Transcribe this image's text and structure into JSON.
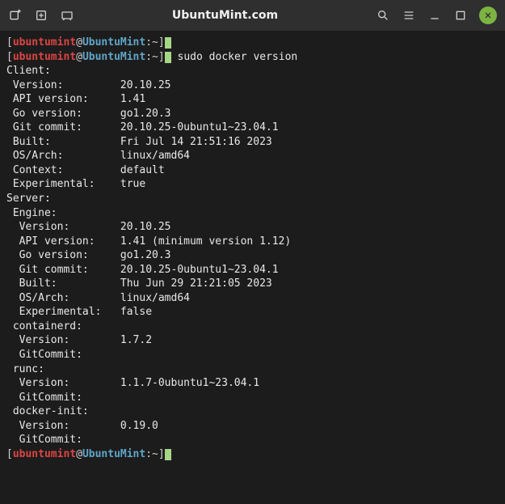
{
  "titlebar": {
    "title": "UbuntuMint.com"
  },
  "prompt": {
    "user": "ubuntumint",
    "host": "UbuntuMint",
    "path": "~"
  },
  "command": "sudo docker version",
  "output": {
    "client_header": "Client:",
    "client_kv": [
      {
        "k": " Version:",
        "v": "20.10.25"
      },
      {
        "k": " API version:",
        "v": "1.41"
      },
      {
        "k": " Go version:",
        "v": "go1.20.3"
      },
      {
        "k": " Git commit:",
        "v": "20.10.25-0ubuntu1~23.04.1"
      },
      {
        "k": " Built:",
        "v": "Fri Jul 14 21:51:16 2023"
      },
      {
        "k": " OS/Arch:",
        "v": "linux/amd64"
      },
      {
        "k": " Context:",
        "v": "default"
      },
      {
        "k": " Experimental:",
        "v": "true"
      }
    ],
    "server_header": "Server:",
    "server_sections": [
      {
        "title": " Engine:",
        "kv": [
          {
            "k": "  Version:",
            "v": "20.10.25"
          },
          {
            "k": "  API version:",
            "v": "1.41 (minimum version 1.12)"
          },
          {
            "k": "  Go version:",
            "v": "go1.20.3"
          },
          {
            "k": "  Git commit:",
            "v": "20.10.25-0ubuntu1~23.04.1"
          },
          {
            "k": "  Built:",
            "v": "Thu Jun 29 21:21:05 2023"
          },
          {
            "k": "  OS/Arch:",
            "v": "linux/amd64"
          },
          {
            "k": "  Experimental:",
            "v": "false"
          }
        ]
      },
      {
        "title": " containerd:",
        "kv": [
          {
            "k": "  Version:",
            "v": "1.7.2"
          },
          {
            "k": "  GitCommit:",
            "v": ""
          }
        ]
      },
      {
        "title": " runc:",
        "kv": [
          {
            "k": "  Version:",
            "v": "1.1.7-0ubuntu1~23.04.1"
          },
          {
            "k": "  GitCommit:",
            "v": ""
          }
        ]
      },
      {
        "title": " docker-init:",
        "kv": [
          {
            "k": "  Version:",
            "v": "0.19.0"
          },
          {
            "k": "  GitCommit:",
            "v": ""
          }
        ]
      }
    ]
  },
  "kv_col": 18
}
